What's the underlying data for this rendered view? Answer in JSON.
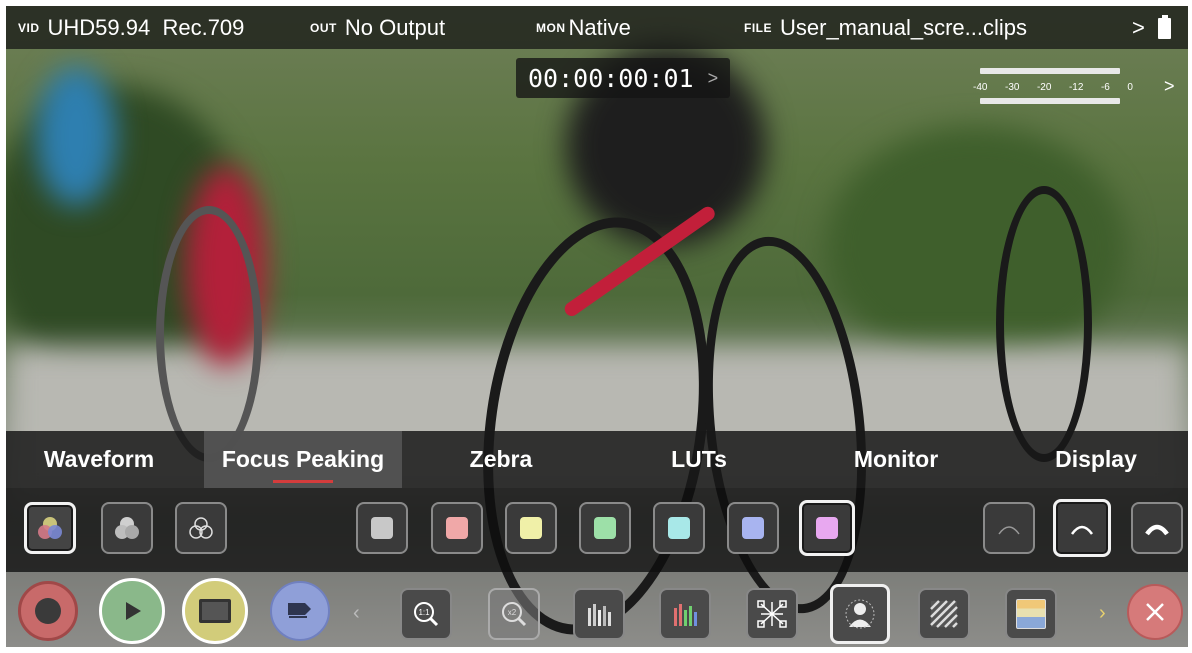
{
  "top_bar": {
    "vid_label": "VID",
    "vid_value": "UHD59.94  Rec.709",
    "out_label": "OUT",
    "out_value": "No Output",
    "mon_label": "MON",
    "mon_value": "Native",
    "file_label": "FILE",
    "file_value": "User_manual_scre...clips",
    "chevron": ">",
    "battery_icon": "battery-icon"
  },
  "timecode": {
    "value": "00:00:00:01",
    "chevron": ">"
  },
  "audio_meter": {
    "ticks": [
      "-40",
      "-30",
      "-20",
      "-12",
      "-6",
      "0"
    ],
    "chevron": ">"
  },
  "menu_tabs": [
    {
      "label": "Waveform",
      "active": false
    },
    {
      "label": "Focus Peaking",
      "active": true
    },
    {
      "label": "Zebra",
      "active": false
    },
    {
      "label": "LUTs",
      "active": false
    },
    {
      "label": "Monitor",
      "active": false
    },
    {
      "label": "Display",
      "active": false
    }
  ],
  "peaking_colors": [
    "#c8c8c8",
    "#f0a8a8",
    "#f0f0a8",
    "#9de0a8",
    "#a8e8e8",
    "#a8b4f0",
    "#e8a8f0"
  ],
  "accent": "#d43c3c",
  "bottom_bar": {
    "buttons": [
      "record",
      "play",
      "playback-mode",
      "tag",
      "zoom-1-1",
      "zoom-x2",
      "waveform-luma",
      "waveform-rgb",
      "network",
      "focus-peaking",
      "zebra",
      "false-color",
      "close"
    ],
    "zoom_1_label": "1:1",
    "zoom_2_label": "x2"
  }
}
